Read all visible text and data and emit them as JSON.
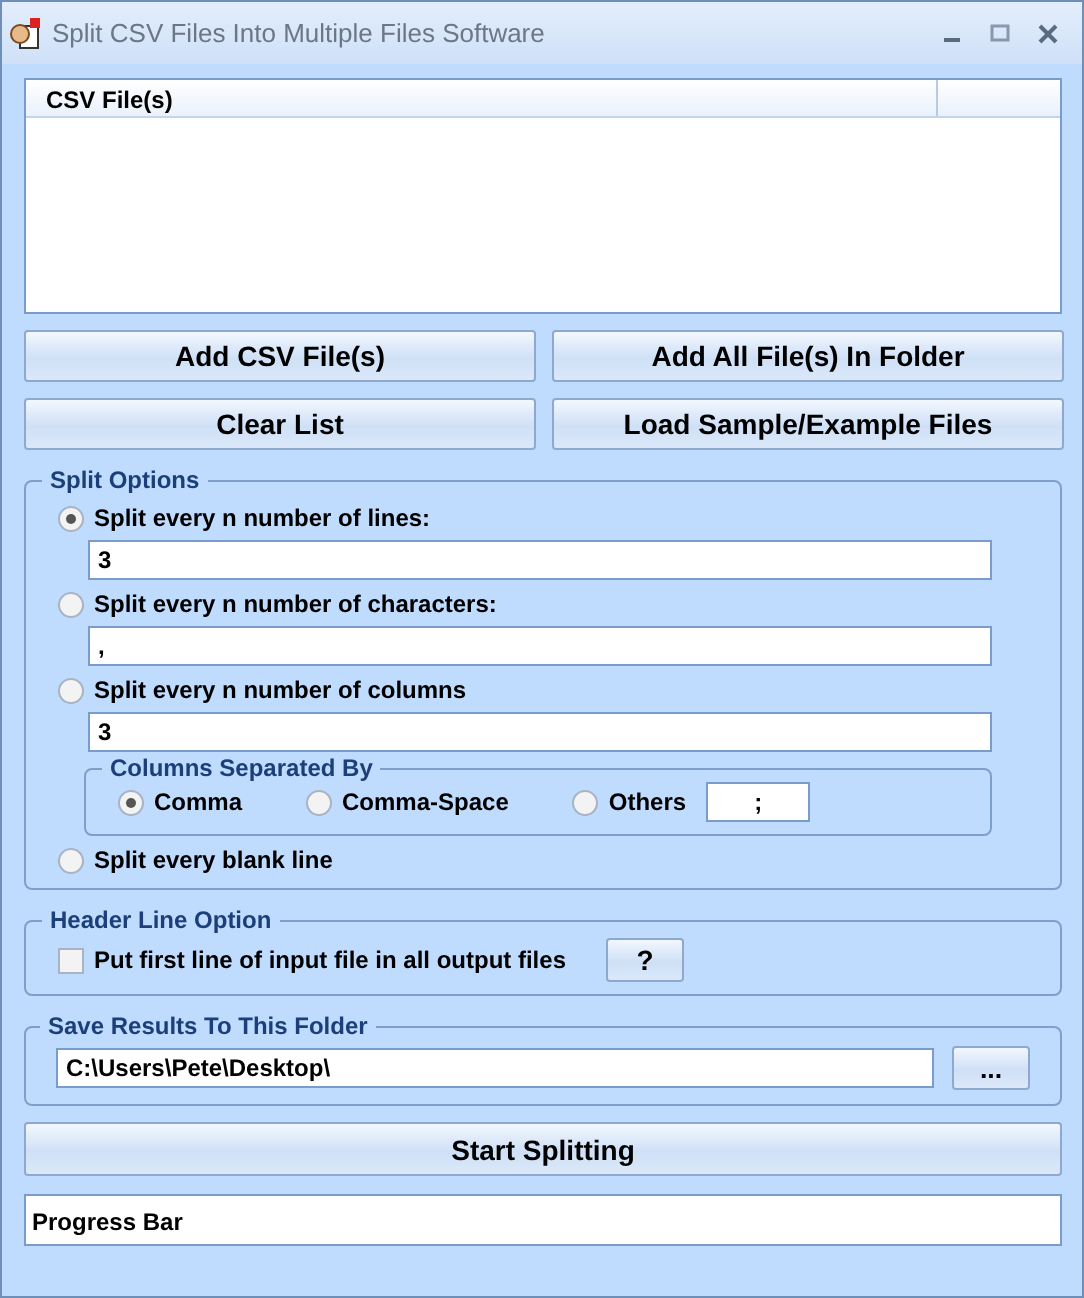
{
  "window": {
    "title": "Split CSV Files Into Multiple Files Software"
  },
  "file_list": {
    "columns": [
      "CSV File(s)"
    ]
  },
  "buttons": [
    {
      "label": "Add CSV File(s)"
    },
    {
      "label": "Add All File(s) In Folder"
    },
    {
      "label": "Clear List"
    },
    {
      "label": "Load Sample/Example Files"
    }
  ],
  "split_options": {
    "title": "Split Options",
    "options": [
      {
        "label": "Split every n number of lines:",
        "selected": true,
        "value": "3"
      },
      {
        "label": "Split every n number of characters:",
        "selected": false,
        "value": ","
      },
      {
        "label": "Split every n number of columns",
        "selected": false,
        "value": "3",
        "separator": {
          "title": "Columns Separated By",
          "choices": [
            {
              "label": "Comma",
              "selected": true
            },
            {
              "label": "Comma-Space",
              "selected": false
            },
            {
              "label": "Others",
              "selected": false,
              "value": ";"
            }
          ]
        }
      },
      {
        "label": "Split every blank line",
        "selected": false
      }
    ]
  },
  "header_option": {
    "title": "Header Line Option",
    "checkbox": {
      "label": "Put first line of input file in all output files",
      "checked": false
    },
    "help_button": "?"
  },
  "save_folder": {
    "title": "Save Results To This Folder",
    "path": "C:\\Users\\Pete\\Desktop\\",
    "browse_button": "..."
  },
  "start_button": "Start Splitting",
  "progress_bar": {
    "label": "Progress Bar"
  }
}
